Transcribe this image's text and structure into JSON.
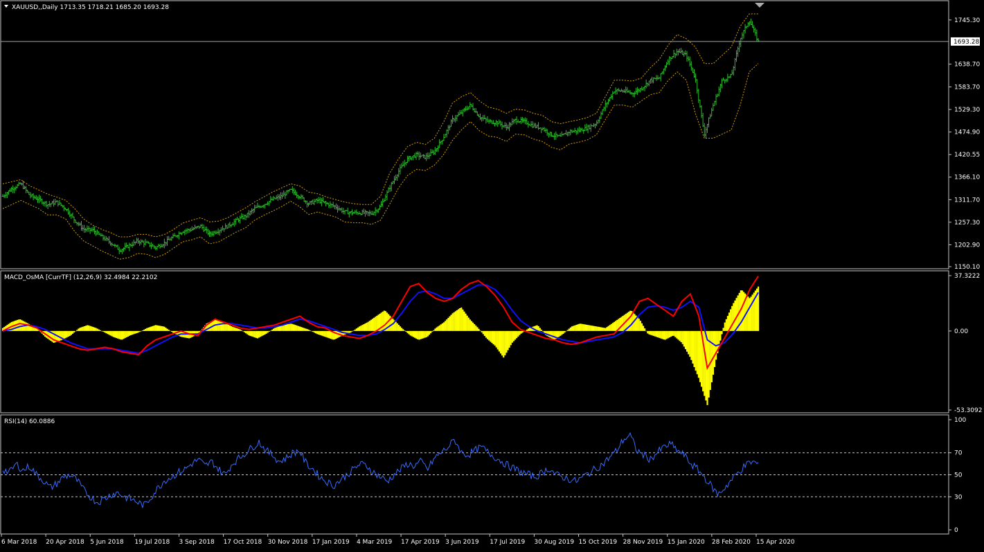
{
  "colors": {
    "background": "#000000",
    "frame": "#c8c8c8",
    "text": "#ffffff",
    "bars": "#2fbf2f",
    "envelope": "#d9a200",
    "current_price_line": "#9aa0a6",
    "histogram": "#ffff00",
    "macd_line": "#ff0000",
    "signal_line": "#1010ff",
    "rsi_line": "#3a6cff",
    "rsi_levels": "#c8c8c8",
    "price_tag_bg": "#ffffff",
    "price_tag_text": "#000000"
  },
  "chart_data": [
    {
      "type": "ohlc",
      "name": "price",
      "header_text": "XAUUSD,,Daily  1713.35 1718.21 1685.20 1693.28",
      "header_icon": "triangle-down-icon",
      "last": {
        "open": 1713.35,
        "high": 1718.21,
        "low": 1685.2,
        "close": 1693.28
      },
      "current_price_label": "1693.28",
      "ylim": [
        1150.1,
        1760.0
      ],
      "y_ticks": [
        "1745.30",
        "1693.28",
        "1638.70",
        "1583.70",
        "1529.30",
        "1474.90",
        "1420.55",
        "1366.10",
        "1311.70",
        "1257.30",
        "1202.90",
        "1150.10"
      ],
      "x_categories": [
        "6 Mar 2018",
        "20 Apr 2018",
        "5 Jun 2018",
        "19 Jul 2018",
        "3 Sep 2018",
        "17 Oct 2018",
        "30 Nov 2018",
        "17 Jan 2019",
        "4 Mar 2019",
        "17 Apr 2019",
        "3 Jun 2019",
        "17 Jul 2019",
        "30 Aug 2019",
        "15 Oct 2019",
        "28 Nov 2019",
        "15 Jan 2020",
        "28 Feb 2020",
        "15 Apr 2020"
      ],
      "close_path": [
        1320,
        1338,
        1350,
        1322,
        1312,
        1300,
        1306,
        1290,
        1262,
        1240,
        1238,
        1222,
        1208,
        1190,
        1200,
        1212,
        1206,
        1196,
        1208,
        1222,
        1236,
        1240,
        1248,
        1228,
        1238,
        1248,
        1262,
        1272,
        1290,
        1300,
        1312,
        1320,
        1335,
        1320,
        1302,
        1310,
        1302,
        1295,
        1282,
        1280,
        1280,
        1278,
        1295,
        1340,
        1380,
        1410,
        1420,
        1414,
        1428,
        1462,
        1504,
        1522,
        1540,
        1512,
        1500,
        1498,
        1486,
        1504,
        1500,
        1490,
        1484,
        1468,
        1463,
        1476,
        1478,
        1485,
        1496,
        1540,
        1575,
        1574,
        1568,
        1580,
        1600,
        1605,
        1650,
        1670,
        1660,
        1605,
        1470,
        1540,
        1600,
        1610,
        1700,
        1745,
        1693.28
      ],
      "envelope_upper": [
        1350,
        1355,
        1360,
        1345,
        1335,
        1325,
        1318,
        1310,
        1290,
        1265,
        1250,
        1240,
        1232,
        1222,
        1222,
        1228,
        1228,
        1222,
        1228,
        1240,
        1255,
        1262,
        1268,
        1258,
        1260,
        1268,
        1280,
        1292,
        1306,
        1318,
        1330,
        1340,
        1350,
        1345,
        1330,
        1326,
        1318,
        1312,
        1306,
        1302,
        1300,
        1300,
        1320,
        1375,
        1410,
        1440,
        1450,
        1445,
        1460,
        1498,
        1545,
        1560,
        1570,
        1550,
        1535,
        1530,
        1520,
        1530,
        1528,
        1520,
        1515,
        1500,
        1495,
        1500,
        1504,
        1510,
        1520,
        1560,
        1600,
        1600,
        1598,
        1605,
        1630,
        1650,
        1685,
        1710,
        1700,
        1680,
        1640,
        1640,
        1660,
        1680,
        1730,
        1760,
        1760
      ],
      "envelope_lower": [
        1290,
        1300,
        1310,
        1300,
        1290,
        1275,
        1275,
        1265,
        1235,
        1212,
        1200,
        1188,
        1178,
        1168,
        1172,
        1182,
        1180,
        1172,
        1180,
        1195,
        1210,
        1215,
        1222,
        1205,
        1210,
        1222,
        1234,
        1244,
        1262,
        1274,
        1284,
        1295,
        1308,
        1295,
        1276,
        1282,
        1276,
        1270,
        1258,
        1256,
        1256,
        1252,
        1262,
        1300,
        1340,
        1370,
        1385,
        1382,
        1395,
        1420,
        1455,
        1480,
        1500,
        1478,
        1465,
        1462,
        1452,
        1470,
        1468,
        1458,
        1452,
        1438,
        1432,
        1446,
        1450,
        1456,
        1468,
        1505,
        1540,
        1540,
        1535,
        1550,
        1565,
        1570,
        1600,
        1620,
        1600,
        1520,
        1460,
        1460,
        1470,
        1480,
        1540,
        1620,
        1640
      ]
    },
    {
      "type": "histogram+lines",
      "name": "macd",
      "header_text": "MACD_OsMA [CurrTF] (12,26,9) 32.4984 22.2102",
      "ylim": [
        -53.3092,
        37.3222
      ],
      "y_ticks": [
        "37.3222",
        "0.00",
        "-53.3092"
      ],
      "histogram": [
        2,
        6,
        8,
        5,
        2,
        -4,
        -8,
        -6,
        -3,
        2,
        4,
        2,
        -1,
        -4,
        -6,
        -3,
        -1,
        2,
        4,
        3,
        -1,
        -4,
        -5,
        -2,
        5,
        8,
        6,
        3,
        1,
        -3,
        -5,
        -2,
        2,
        4,
        5,
        3,
        1,
        -2,
        -4,
        -6,
        -3,
        -1,
        3,
        6,
        10,
        14,
        8,
        2,
        -3,
        -6,
        -4,
        2,
        6,
        12,
        16,
        8,
        2,
        -5,
        -10,
        -18,
        -8,
        -2,
        2,
        4,
        -3,
        -6,
        -2,
        3,
        5,
        4,
        3,
        2,
        6,
        10,
        14,
        8,
        -2,
        -4,
        -6,
        -3,
        -8,
        -18,
        -32,
        -50,
        -20,
        5,
        18,
        28,
        22,
        30
      ],
      "macd": [
        0,
        3,
        5,
        4,
        2,
        -2,
        -6,
        -8,
        -10,
        -12,
        -13,
        -12,
        -11,
        -12,
        -14,
        -15,
        -16,
        -10,
        -6,
        -4,
        -2,
        0,
        -2,
        -3,
        4,
        8,
        6,
        4,
        2,
        1,
        2,
        3,
        4,
        6,
        8,
        10,
        6,
        3,
        2,
        -1,
        -3,
        -4,
        -5,
        -3,
        0,
        4,
        10,
        20,
        30,
        32,
        26,
        22,
        20,
        22,
        28,
        32,
        34,
        30,
        24,
        16,
        6,
        1,
        -1,
        -3,
        -5,
        -6,
        -8,
        -9,
        -8,
        -6,
        -4,
        -3,
        -2,
        4,
        10,
        20,
        22,
        18,
        14,
        10,
        20,
        25,
        10,
        -25,
        -15,
        -5,
        5,
        15,
        28,
        37
      ],
      "signal": [
        0,
        1,
        3,
        4,
        3,
        1,
        -2,
        -5,
        -8,
        -10,
        -12,
        -12,
        -12,
        -12,
        -13,
        -14,
        -15,
        -13,
        -10,
        -7,
        -4,
        -2,
        -2,
        -2,
        1,
        4,
        5,
        5,
        4,
        3,
        2,
        2,
        3,
        4,
        6,
        8,
        7,
        5,
        3,
        1,
        -1,
        -2,
        -3,
        -3,
        -2,
        1,
        5,
        12,
        20,
        26,
        27,
        25,
        22,
        22,
        25,
        28,
        31,
        31,
        28,
        22,
        14,
        7,
        3,
        0,
        -2,
        -4,
        -6,
        -7,
        -8,
        -7,
        -6,
        -5,
        -4,
        -1,
        4,
        11,
        16,
        17,
        16,
        14,
        16,
        20,
        16,
        -6,
        -10,
        -8,
        -2,
        6,
        16,
        26
      ]
    },
    {
      "type": "line",
      "name": "rsi",
      "header_text": "RSI(14) 60.0886",
      "ylim": [
        0,
        100
      ],
      "y_ticks": [
        "100",
        "70",
        "50",
        "30",
        "0"
      ],
      "levels": [
        70,
        50,
        30
      ],
      "values": [
        55,
        52,
        60,
        54,
        58,
        50,
        45,
        38,
        42,
        48,
        50,
        45,
        36,
        30,
        25,
        28,
        32,
        34,
        30,
        28,
        25,
        22,
        30,
        38,
        45,
        48,
        52,
        55,
        60,
        64,
        58,
        62,
        55,
        50,
        60,
        65,
        70,
        75,
        80,
        72,
        68,
        62,
        65,
        70,
        72,
        60,
        55,
        48,
        44,
        40,
        45,
        50,
        55,
        60,
        58,
        52,
        48,
        44,
        50,
        55,
        60,
        58,
        62,
        55,
        65,
        70,
        75,
        82,
        70,
        68,
        72,
        75,
        70,
        66,
        62,
        58,
        55,
        52,
        50,
        48,
        52,
        56,
        50,
        48,
        46,
        44,
        48,
        52,
        56,
        60,
        66,
        72,
        82,
        86,
        72,
        68,
        64,
        70,
        75,
        78,
        72,
        68,
        60,
        55,
        48,
        40,
        32,
        38,
        45,
        52,
        58,
        62,
        60
      ]
    }
  ]
}
